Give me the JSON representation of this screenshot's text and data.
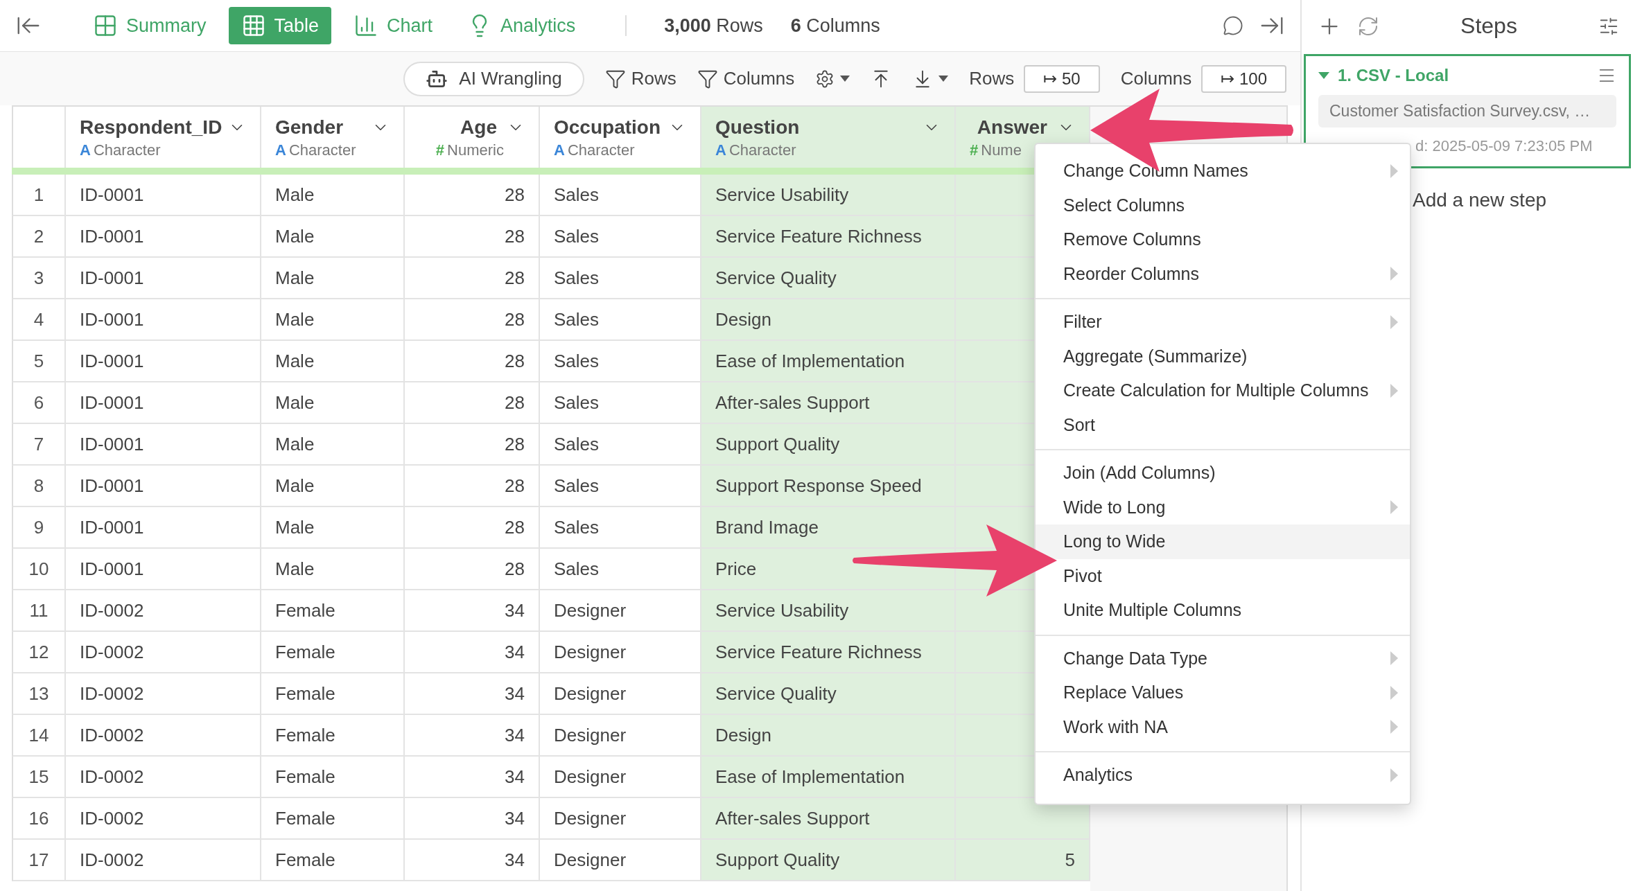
{
  "view_tabs": [
    {
      "label": "Summary",
      "kind": "summary",
      "selected": false
    },
    {
      "label": "Table",
      "kind": "table",
      "selected": true
    },
    {
      "label": "Chart",
      "kind": "chart",
      "selected": false
    },
    {
      "label": "Analytics",
      "kind": "analytics",
      "selected": false
    }
  ],
  "counts": [
    "**3,000** Rows",
    "**6** Columns"
  ],
  "toolbar": {
    "ai_button": "AI Wrangling",
    "row_filter": "Rows",
    "column_filter": "Columns",
    "rows_label": "Rows",
    "rows_limit": "↦ 50",
    "columns_label": "Columns",
    "columns_limit": "↦ 100"
  },
  "table": {
    "columns": [
      {
        "name": "Respondent_ID",
        "type_icon": "A",
        "type": "Character",
        "kind": "character",
        "highlighted": false
      },
      {
        "name": "Gender",
        "type_icon": "A",
        "type": "Character",
        "kind": "character",
        "highlighted": false
      },
      {
        "name": "Age",
        "type_icon": "#",
        "type": "Numeric",
        "kind": "numeric",
        "highlighted": false
      },
      {
        "name": "Occupation",
        "type_icon": "A",
        "type": "Character",
        "kind": "character",
        "highlighted": false
      },
      {
        "name": "Question",
        "type_icon": "A",
        "type": "Character",
        "kind": "character",
        "highlighted": true
      },
      {
        "name": "Answer",
        "type_icon": "#",
        "type": "Nume",
        "kind": "numeric",
        "highlighted": true
      }
    ],
    "rows": [
      {
        "number": "1",
        "cells": [
          "ID-0001",
          "Male",
          "28",
          "Sales",
          "Service Usability"
        ]
      },
      {
        "number": "2",
        "cells": [
          "ID-0001",
          "Male",
          "28",
          "Sales",
          "Service Feature Richness"
        ]
      },
      {
        "number": "3",
        "cells": [
          "ID-0001",
          "Male",
          "28",
          "Sales",
          "Service Quality"
        ]
      },
      {
        "number": "4",
        "cells": [
          "ID-0001",
          "Male",
          "28",
          "Sales",
          "Design"
        ]
      },
      {
        "number": "5",
        "cells": [
          "ID-0001",
          "Male",
          "28",
          "Sales",
          "Ease of Implementation"
        ]
      },
      {
        "number": "6",
        "cells": [
          "ID-0001",
          "Male",
          "28",
          "Sales",
          "After-sales Support"
        ]
      },
      {
        "number": "7",
        "cells": [
          "ID-0001",
          "Male",
          "28",
          "Sales",
          "Support Quality"
        ]
      },
      {
        "number": "8",
        "cells": [
          "ID-0001",
          "Male",
          "28",
          "Sales",
          "Support Response Speed"
        ]
      },
      {
        "number": "9",
        "cells": [
          "ID-0001",
          "Male",
          "28",
          "Sales",
          "Brand Image"
        ]
      },
      {
        "number": "10",
        "cells": [
          "ID-0001",
          "Male",
          "28",
          "Sales",
          "Price"
        ]
      },
      {
        "number": "11",
        "cells": [
          "ID-0002",
          "Female",
          "34",
          "Designer",
          "Service Usability"
        ]
      },
      {
        "number": "12",
        "cells": [
          "ID-0002",
          "Female",
          "34",
          "Designer",
          "Service Feature Richness"
        ]
      },
      {
        "number": "13",
        "cells": [
          "ID-0002",
          "Female",
          "34",
          "Designer",
          "Service Quality"
        ]
      },
      {
        "number": "14",
        "cells": [
          "ID-0002",
          "Female",
          "34",
          "Designer",
          "Design"
        ]
      },
      {
        "number": "15",
        "cells": [
          "ID-0002",
          "Female",
          "34",
          "Designer",
          "Ease of Implementation"
        ]
      },
      {
        "number": "16",
        "cells": [
          "ID-0002",
          "Female",
          "34",
          "Designer",
          "After-sales Support"
        ]
      },
      {
        "number": "17",
        "cells": [
          "ID-0002",
          "Female",
          "34",
          "Designer",
          "Support Quality",
          "5"
        ]
      }
    ]
  },
  "column_menu": {
    "sections": [
      [
        {
          "label": "Change Column Names",
          "submenu": true,
          "selected": false
        },
        {
          "label": "Select Columns",
          "submenu": false,
          "selected": false
        },
        {
          "label": "Remove Columns",
          "submenu": false,
          "selected": false
        },
        {
          "label": "Reorder Columns",
          "submenu": true,
          "selected": false
        }
      ],
      [
        {
          "label": "Filter",
          "submenu": true,
          "selected": false
        },
        {
          "label": "Aggregate (Summarize)",
          "submenu": false,
          "selected": false
        },
        {
          "label": "Create Calculation for Multiple Columns",
          "submenu": true,
          "selected": false
        },
        {
          "label": "Sort",
          "submenu": false,
          "selected": false
        }
      ],
      [
        {
          "label": "Join (Add Columns)",
          "submenu": false,
          "selected": false
        },
        {
          "label": "Wide to Long",
          "submenu": true,
          "selected": false
        },
        {
          "label": "Long to Wide",
          "submenu": false,
          "selected": true
        },
        {
          "label": "Pivot",
          "submenu": false,
          "selected": false
        },
        {
          "label": "Unite Multiple Columns",
          "submenu": false,
          "selected": false
        }
      ],
      [
        {
          "label": "Change Data Type",
          "submenu": true,
          "selected": false
        },
        {
          "label": "Replace Values",
          "submenu": true,
          "selected": false
        },
        {
          "label": "Work with NA",
          "submenu": true,
          "selected": false
        }
      ],
      [
        {
          "label": "Analytics",
          "submenu": true,
          "selected": false
        }
      ]
    ]
  },
  "steps_panel": {
    "title": "Steps",
    "steps": [
      {
        "title": "1. CSV - Local",
        "expanded": true,
        "selected": true,
        "source": "Customer Satisfaction Survey.csv, …",
        "timestamp": "d: 2025-05-09 7:23:05 PM"
      }
    ],
    "add_step": "Add a new step"
  }
}
